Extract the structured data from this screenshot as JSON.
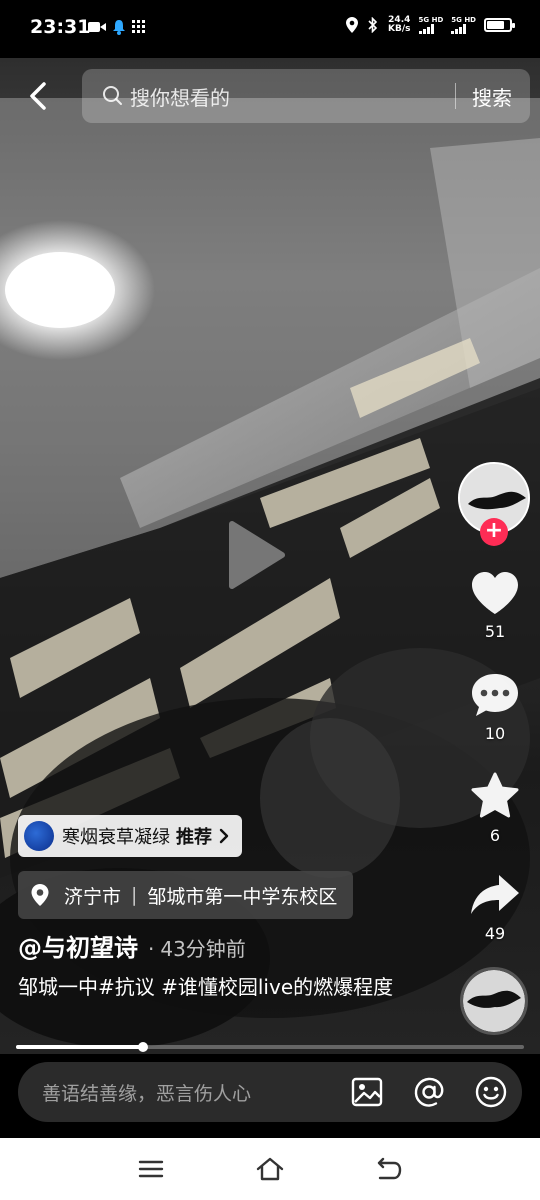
{
  "status_bar": {
    "time": "23:31",
    "net_speed_value": "24.4",
    "net_speed_unit": "KB/s",
    "sim1_label": "5G HD",
    "sim2_label": "5G HD",
    "left_icons": [
      "video-icon",
      "notification-bell-icon",
      "grid-icon"
    ],
    "right_icons": [
      "location-icon",
      "bluetooth-icon",
      "signal-icon",
      "battery-icon"
    ],
    "battery_level": 0.8
  },
  "top_bar": {
    "search_placeholder": "搜你想看的",
    "search_button": "搜索"
  },
  "actions": {
    "likes": "51",
    "comments": "10",
    "favorites": "6",
    "shares": "49"
  },
  "recommend": {
    "label": "寒烟衰草凝绿",
    "suffix": "推荐"
  },
  "location": {
    "city": "济宁市",
    "separator": "|",
    "place": "邹城市第一中学东校区"
  },
  "author": {
    "name": "@与初望诗",
    "separator": "·",
    "time": "43分钟前"
  },
  "caption": "邹城一中#抗议 #谁懂校园live的燃爆程度",
  "progress": 0.25,
  "comment": {
    "placeholder": "善语结善缘，恶言伤人心"
  },
  "colors": {
    "accent": "#fe2c55",
    "comment_bg": "#2b2b2b",
    "nav_bg": "#ffffff"
  }
}
